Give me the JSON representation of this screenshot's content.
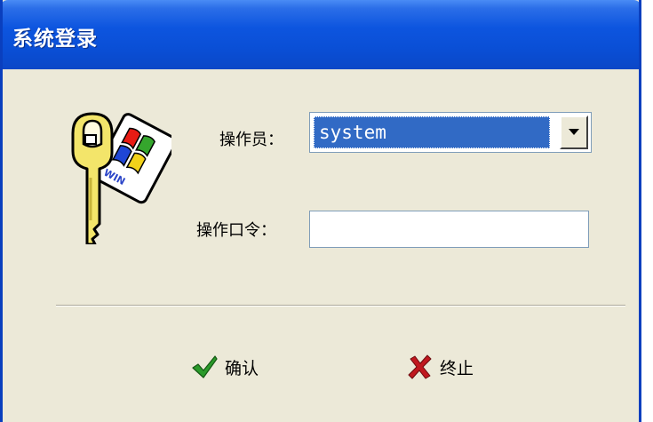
{
  "window": {
    "title": "系统登录"
  },
  "form": {
    "operator_label": "操作员：",
    "operator_value": "system",
    "password_label": "操作口令：",
    "password_value": ""
  },
  "buttons": {
    "ok_label": "确认",
    "cancel_label": "终止"
  },
  "icons": {
    "login": "keys-icon",
    "ok": "checkmark-icon",
    "cancel": "x-mark-icon"
  },
  "colors": {
    "titlebar": "#0a4fd6",
    "window_bg": "#ece9d8",
    "selection": "#316ac5",
    "ok_icon": "#2a9a2a",
    "cancel_icon": "#c0181f"
  }
}
